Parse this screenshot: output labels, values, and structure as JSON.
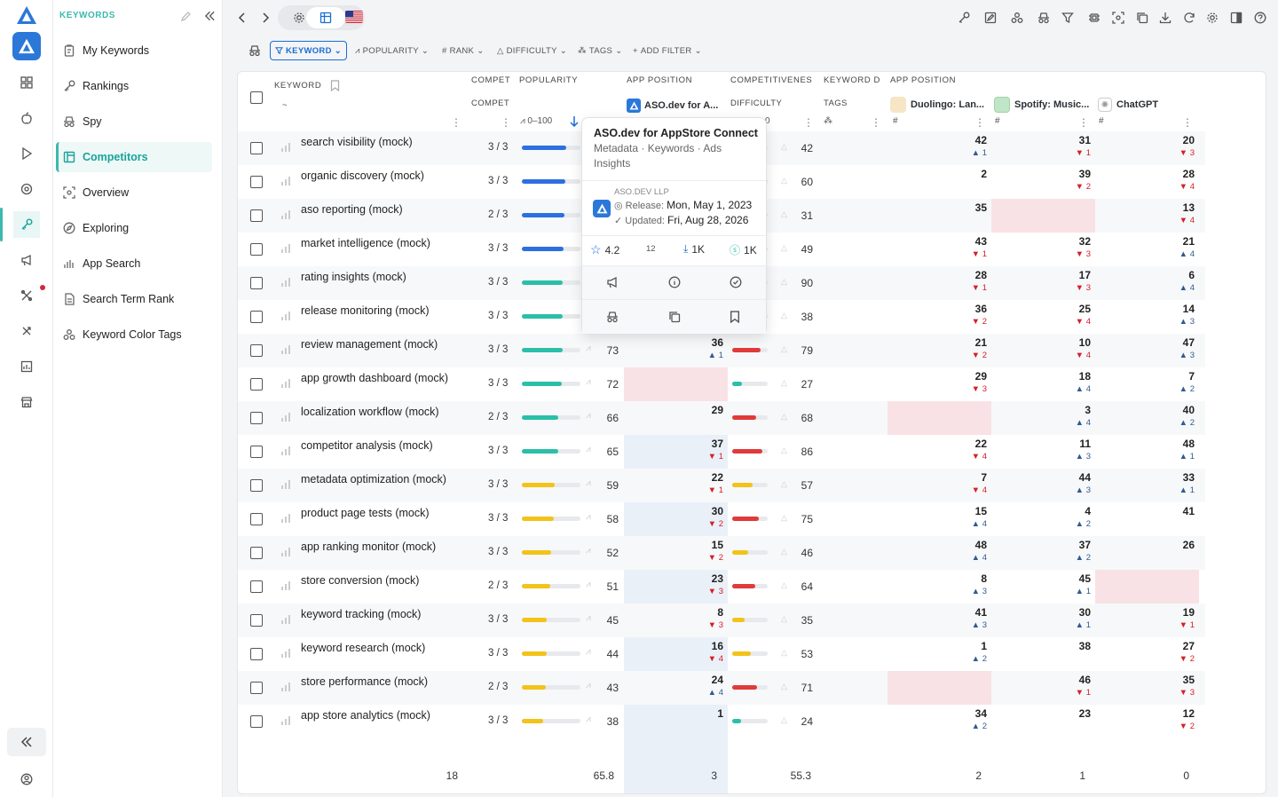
{
  "sidebar": {
    "header": "KEYWORDS",
    "items": [
      {
        "label": "My Keywords",
        "icon": "clipboard-icon"
      },
      {
        "label": "Rankings",
        "icon": "key-icon"
      },
      {
        "label": "Spy",
        "icon": "incognito-icon"
      },
      {
        "label": "Competitors",
        "icon": "layout-icon",
        "active": true
      },
      {
        "label": "Overview",
        "icon": "focus-icon"
      },
      {
        "label": "Exploring",
        "icon": "compass-icon"
      },
      {
        "label": "App Search",
        "icon": "chart-icon"
      },
      {
        "label": "Search Term Rank",
        "icon": "document-icon"
      },
      {
        "label": "Keyword Color Tags",
        "icon": "tags-icon"
      }
    ]
  },
  "filters": [
    {
      "label": "KEYWORD",
      "active": true
    },
    {
      "label": "POPULARITY"
    },
    {
      "label": "RANK"
    },
    {
      "label": "DIFFICULTY"
    },
    {
      "label": "TAGS"
    },
    {
      "label": "ADD FILTER"
    }
  ],
  "headers": {
    "keyword": "KEYWORD",
    "tilde": "~",
    "compet": "COMPETI",
    "compet2": "COMPET",
    "popularity": "POPULARITY",
    "pop_range": "0–100",
    "app_position": "APP POSITION",
    "app_position2": "APP POSITION",
    "competitiveness": "COMPETITIVENESS",
    "difficulty": "DIFFICULTY",
    "diff_range": "0",
    "keyword_d": "KEYWORD D",
    "tags": "TAGS",
    "app1": "ASO.dev for A...",
    "app2": "Duolingo: Lan...",
    "app3": "Spotify: Music...",
    "app4": "ChatGPT",
    "hash": "#"
  },
  "rows": [
    {
      "kw": "search visibility (mock)",
      "comp": "3 / 3",
      "pop": 80,
      "pc": "#2d6fe0",
      "pos1": "",
      "c1": "",
      "d1": "up",
      "diff": 42,
      "dc": "#e03a3a",
      "p2": "42",
      "c2": "1",
      "d2": "up",
      "p3": "31",
      "c3": "1",
      "d3": "dn",
      "p4": "20",
      "c4": "3",
      "d4": "dn"
    },
    {
      "kw": "organic discovery (mock)",
      "comp": "3 / 3",
      "pop": 78,
      "pc": "#2d6fe0",
      "pos1": "",
      "c1": "",
      "d1": "up",
      "diff": 60,
      "dc": "#e03a3a",
      "p2": "2",
      "c2": "",
      "d2": "up",
      "p3": "39",
      "c3": "2",
      "d3": "dn",
      "p4": "28",
      "c4": "4",
      "d4": "dn"
    },
    {
      "kw": "aso reporting (mock)",
      "comp": "2 / 3",
      "pop": 76,
      "pc": "#2d6fe0",
      "pos1": "",
      "c1": "",
      "d1": "up",
      "diff": 31,
      "dc": "#e03a3a",
      "p2": "35",
      "c2": "",
      "d2": "up",
      "p3": "",
      "c3": "",
      "d3": "up",
      "p4": "13",
      "c4": "4",
      "d4": "dn"
    },
    {
      "kw": "market intelligence (mock)",
      "comp": "3 / 3",
      "pop": 75,
      "pc": "#2d6fe0",
      "pos1": "",
      "c1": "",
      "d1": "up",
      "diff": 49,
      "dc": "#e03a3a",
      "p2": "43",
      "c2": "1",
      "d2": "dn",
      "p3": "32",
      "c3": "3",
      "d3": "dn",
      "p4": "21",
      "c4": "4",
      "d4": "up"
    },
    {
      "kw": "rating insights (mock)",
      "comp": "3 / 3",
      "pop": 74,
      "pc": "#2bbfa8",
      "pos1": "",
      "c1": "",
      "d1": "up",
      "diff": 90,
      "dc": "#e03a3a",
      "p2": "28",
      "c2": "1",
      "d2": "dn",
      "p3": "17",
      "c3": "3",
      "d3": "dn",
      "p4": "6",
      "c4": "4",
      "d4": "up"
    },
    {
      "kw": "release monitoring (mock)",
      "comp": "3 / 3",
      "pop": 74,
      "pc": "#2bbfa8",
      "pos1": "",
      "c1": "",
      "d1": "up",
      "diff": 38,
      "dc": "#e03a3a",
      "p2": "36",
      "c2": "2",
      "d2": "dn",
      "p3": "25",
      "c3": "4",
      "d3": "dn",
      "p4": "14",
      "c4": "3",
      "d4": "up"
    },
    {
      "kw": "review management (mock)",
      "comp": "3 / 3",
      "pop": 73,
      "pc": "#2bbfa8",
      "pos1": "36",
      "c1": "1",
      "d1": "up",
      "diff": 79,
      "dc": "#e03a3a",
      "p2": "21",
      "c2": "2",
      "d2": "dn",
      "p3": "10",
      "c3": "4",
      "d3": "dn",
      "p4": "47",
      "c4": "3",
      "d4": "up"
    },
    {
      "kw": "app growth dashboard (mock)",
      "comp": "3 / 3",
      "pop": 72,
      "pc": "#2bbfa8",
      "pos1": "",
      "c1": "",
      "d1": "up",
      "diff": 27,
      "dc": "#2bbfa8",
      "p2": "29",
      "c2": "3",
      "d2": "dn",
      "p3": "18",
      "c3": "4",
      "d3": "up",
      "p4": "7",
      "c4": "2",
      "d4": "up"
    },
    {
      "kw": "localization workflow (mock)",
      "comp": "2 / 3",
      "pop": 66,
      "pc": "#2bbfa8",
      "pos1": "29",
      "c1": "",
      "d1": "up",
      "diff": 68,
      "dc": "#e03a3a",
      "p2": "",
      "c2": "",
      "d2": "up",
      "p3": "3",
      "c3": "4",
      "d3": "up",
      "p4": "40",
      "c4": "2",
      "d4": "up"
    },
    {
      "kw": "competitor analysis (mock)",
      "comp": "3 / 3",
      "pop": 65,
      "pc": "#2bbfa8",
      "pos1": "37",
      "c1": "1",
      "d1": "dn",
      "diff": 86,
      "dc": "#e03a3a",
      "p2": "22",
      "c2": "4",
      "d2": "dn",
      "p3": "11",
      "c3": "3",
      "d3": "up",
      "p4": "48",
      "c4": "1",
      "d4": "up"
    },
    {
      "kw": "metadata optimization (mock)",
      "comp": "3 / 3",
      "pop": 59,
      "pc": "#f2c318",
      "pos1": "22",
      "c1": "1",
      "d1": "dn",
      "diff": 57,
      "dc": "#f2c318",
      "p2": "7",
      "c2": "4",
      "d2": "dn",
      "p3": "44",
      "c3": "3",
      "d3": "up",
      "p4": "33",
      "c4": "1",
      "d4": "up"
    },
    {
      "kw": "product page tests (mock)",
      "comp": "3 / 3",
      "pop": 58,
      "pc": "#f2c318",
      "pos1": "30",
      "c1": "2",
      "d1": "dn",
      "diff": 75,
      "dc": "#e03a3a",
      "p2": "15",
      "c2": "4",
      "d2": "up",
      "p3": "4",
      "c3": "2",
      "d3": "up",
      "p4": "41",
      "c4": "",
      "d4": "up"
    },
    {
      "kw": "app ranking monitor (mock)",
      "comp": "3 / 3",
      "pop": 52,
      "pc": "#f2c318",
      "pos1": "15",
      "c1": "2",
      "d1": "dn",
      "diff": 46,
      "dc": "#f2c318",
      "p2": "48",
      "c2": "4",
      "d2": "up",
      "p3": "37",
      "c3": "2",
      "d3": "up",
      "p4": "26",
      "c4": "",
      "d4": "up"
    },
    {
      "kw": "store conversion (mock)",
      "comp": "2 / 3",
      "pop": 51,
      "pc": "#f2c318",
      "pos1": "23",
      "c1": "3",
      "d1": "dn",
      "diff": 64,
      "dc": "#e03a3a",
      "p2": "8",
      "c2": "3",
      "d2": "up",
      "p3": "45",
      "c3": "1",
      "d3": "up",
      "p4": "",
      "c4": "",
      "d4": "up"
    },
    {
      "kw": "keyword tracking (mock)",
      "comp": "3 / 3",
      "pop": 45,
      "pc": "#f2c318",
      "pos1": "8",
      "c1": "3",
      "d1": "dn",
      "diff": 35,
      "dc": "#f2c318",
      "p2": "41",
      "c2": "3",
      "d2": "up",
      "p3": "30",
      "c3": "1",
      "d3": "up",
      "p4": "19",
      "c4": "1",
      "d4": "dn"
    },
    {
      "kw": "keyword research (mock)",
      "comp": "3 / 3",
      "pop": 44,
      "pc": "#f2c318",
      "pos1": "16",
      "c1": "4",
      "d1": "dn",
      "diff": 53,
      "dc": "#f2c318",
      "p2": "1",
      "c2": "2",
      "d2": "up",
      "p3": "38",
      "c3": "",
      "d3": "up",
      "p4": "27",
      "c4": "2",
      "d4": "dn"
    },
    {
      "kw": "store performance (mock)",
      "comp": "2 / 3",
      "pop": 43,
      "pc": "#f2c318",
      "pos1": "24",
      "c1": "4",
      "d1": "up",
      "diff": 71,
      "dc": "#e03a3a",
      "p2": "",
      "c2": "",
      "d2": "up",
      "p3": "46",
      "c3": "1",
      "d3": "dn",
      "p4": "35",
      "c4": "3",
      "d4": "dn"
    },
    {
      "kw": "app store analytics (mock)",
      "comp": "3 / 3",
      "pop": 38,
      "pc": "#f2c318",
      "pos1": "1",
      "c1": "",
      "d1": "up",
      "diff": 24,
      "dc": "#2bbfa8",
      "p2": "34",
      "c2": "2",
      "d2": "up",
      "p3": "23",
      "c3": "",
      "d3": "up",
      "p4": "12",
      "c4": "2",
      "d4": "dn"
    }
  ],
  "totals": {
    "count": "18",
    "pop": "65.8",
    "pos1": "3",
    "diff": "55.3",
    "app2": "2",
    "app3": "1",
    "app4": "0"
  },
  "popover": {
    "title": "ASO.dev for AppStore Connect",
    "subtitle": "Metadata · Keywords · Ads Insights",
    "developer": "ASO.DEV LLP",
    "release_label": "Release:",
    "release": "Mon, May 1, 2023",
    "updated_label": "Updated:",
    "updated": "Fri, Aug 28, 2026",
    "rating": "4.2",
    "reviews": "12",
    "downloads": "1K",
    "revenue": "1K"
  }
}
